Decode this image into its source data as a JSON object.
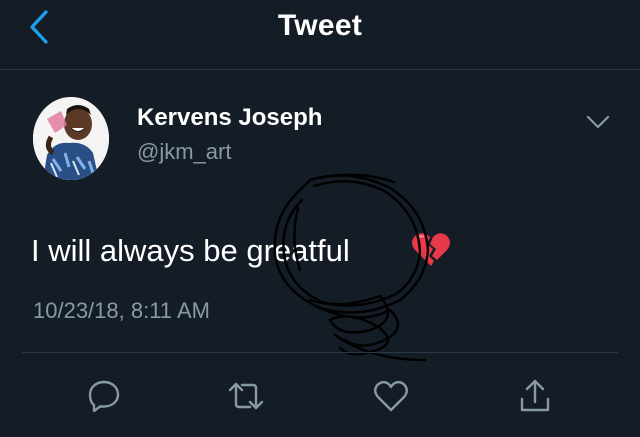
{
  "header": {
    "title": "Tweet",
    "back_icon": "chevron-left-icon"
  },
  "tweet": {
    "author_name": "Kervens Joseph",
    "author_handle": "@jkm_art",
    "text": "I will always be greatful",
    "emoji": "broken-heart",
    "timestamp": "10/23/18, 8:11 AM"
  },
  "actions": [
    {
      "icon": "reply-icon"
    },
    {
      "icon": "retweet-icon"
    },
    {
      "icon": "like-icon"
    },
    {
      "icon": "share-icon"
    }
  ],
  "colors": {
    "background": "#141d26",
    "accent": "#1da1f2",
    "secondary_text": "#8899a6",
    "divider": "#2a3846",
    "heart": "#e0245e"
  }
}
